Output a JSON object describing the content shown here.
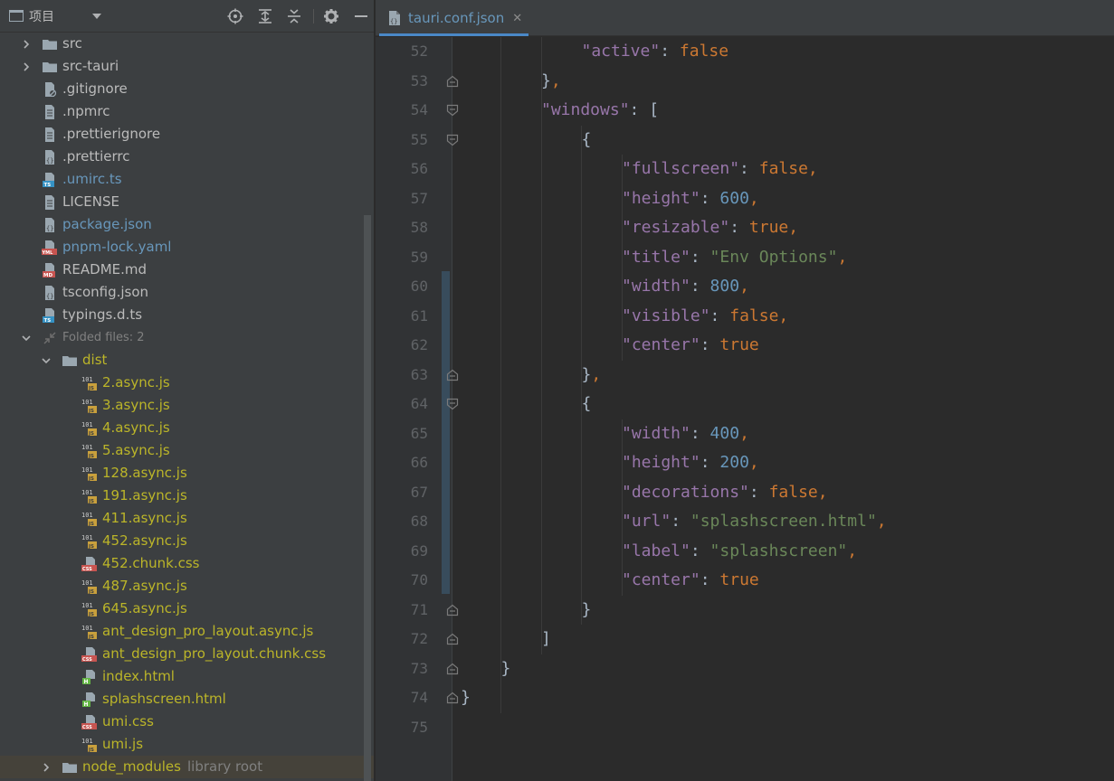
{
  "project_panel": {
    "title": "项目",
    "tree": [
      {
        "label": "src",
        "type": "folder",
        "depth": 0,
        "arrow": "right",
        "color": "default"
      },
      {
        "label": "src-tauri",
        "type": "folder",
        "depth": 0,
        "arrow": "right",
        "color": "default"
      },
      {
        "label": ".gitignore",
        "type": "ignore-file",
        "depth": 0,
        "color": "default"
      },
      {
        "label": ".npmrc",
        "type": "text-file",
        "depth": 0,
        "color": "default"
      },
      {
        "label": ".prettierignore",
        "type": "text-file",
        "depth": 0,
        "color": "default"
      },
      {
        "label": ".prettierrc",
        "type": "json-file",
        "depth": 0,
        "color": "default"
      },
      {
        "label": ".umirc.ts",
        "type": "ts-file",
        "depth": 0,
        "color": "modified"
      },
      {
        "label": "LICENSE",
        "type": "text-file",
        "depth": 0,
        "color": "default"
      },
      {
        "label": "package.json",
        "type": "json-file",
        "depth": 0,
        "color": "modified"
      },
      {
        "label": "pnpm-lock.yaml",
        "type": "yaml-file",
        "depth": 0,
        "color": "modified"
      },
      {
        "label": "README.md",
        "type": "md-file",
        "depth": 0,
        "color": "default"
      },
      {
        "label": "tsconfig.json",
        "type": "json-file",
        "depth": 0,
        "color": "default"
      },
      {
        "label": "typings.d.ts",
        "type": "ts-file",
        "depth": 0,
        "color": "default"
      },
      {
        "label": "Folded files: 2",
        "type": "folded",
        "depth": 0,
        "arrow": "down",
        "color": "dim"
      },
      {
        "label": "dist",
        "type": "folder",
        "depth": 1,
        "arrow": "down",
        "color": "ignored"
      },
      {
        "label": "2.async.js",
        "type": "js-file",
        "depth": 2,
        "color": "ignored"
      },
      {
        "label": "3.async.js",
        "type": "js-file",
        "depth": 2,
        "color": "ignored"
      },
      {
        "label": "4.async.js",
        "type": "js-file",
        "depth": 2,
        "color": "ignored"
      },
      {
        "label": "5.async.js",
        "type": "js-file",
        "depth": 2,
        "color": "ignored"
      },
      {
        "label": "128.async.js",
        "type": "js-file",
        "depth": 2,
        "color": "ignored"
      },
      {
        "label": "191.async.js",
        "type": "js-file",
        "depth": 2,
        "color": "ignored"
      },
      {
        "label": "411.async.js",
        "type": "js-file",
        "depth": 2,
        "color": "ignored"
      },
      {
        "label": "452.async.js",
        "type": "js-file",
        "depth": 2,
        "color": "ignored"
      },
      {
        "label": "452.chunk.css",
        "type": "css-file",
        "depth": 2,
        "color": "ignored"
      },
      {
        "label": "487.async.js",
        "type": "js-file",
        "depth": 2,
        "color": "ignored"
      },
      {
        "label": "645.async.js",
        "type": "js-file",
        "depth": 2,
        "color": "ignored"
      },
      {
        "label": "ant_design_pro_layout.async.js",
        "type": "js-file",
        "depth": 2,
        "color": "ignored"
      },
      {
        "label": "ant_design_pro_layout.chunk.css",
        "type": "css-file",
        "depth": 2,
        "color": "ignored"
      },
      {
        "label": "index.html",
        "type": "html-file",
        "depth": 2,
        "color": "ignored"
      },
      {
        "label": "splashscreen.html",
        "type": "html-file",
        "depth": 2,
        "color": "ignored"
      },
      {
        "label": "umi.css",
        "type": "css-file",
        "depth": 2,
        "color": "ignored"
      },
      {
        "label": "umi.js",
        "type": "js-file",
        "depth": 2,
        "color": "ignored"
      },
      {
        "label": "node_modules",
        "extra": "library root",
        "type": "folder",
        "depth": 1,
        "arrow": "right",
        "color": "ignored",
        "highlight": true
      }
    ]
  },
  "editor": {
    "tab_label": "tauri.conf.json",
    "tab_close": "✕",
    "lines": [
      {
        "num": "52",
        "indent": 5,
        "fold": "",
        "tokens": [
          {
            "t": "\"active\"",
            "c": "k"
          },
          {
            "t": ": ",
            "c": "p"
          },
          {
            "t": "false",
            "c": "b"
          }
        ]
      },
      {
        "num": "53",
        "indent": 4,
        "fold": "end",
        "tokens": [
          {
            "t": "}",
            "c": "p"
          },
          {
            "t": ",",
            "c": "c"
          }
        ]
      },
      {
        "num": "54",
        "indent": 4,
        "fold": "start",
        "tokens": [
          {
            "t": "\"windows\"",
            "c": "k"
          },
          {
            "t": ": [",
            "c": "p"
          }
        ]
      },
      {
        "num": "55",
        "indent": 5,
        "fold": "start",
        "tokens": [
          {
            "t": "{",
            "c": "p"
          }
        ]
      },
      {
        "num": "56",
        "indent": 6,
        "fold": "",
        "tokens": [
          {
            "t": "\"fullscreen\"",
            "c": "k"
          },
          {
            "t": ": ",
            "c": "p"
          },
          {
            "t": "false",
            "c": "b"
          },
          {
            "t": ",",
            "c": "c"
          }
        ]
      },
      {
        "num": "57",
        "indent": 6,
        "fold": "",
        "tokens": [
          {
            "t": "\"height\"",
            "c": "k"
          },
          {
            "t": ": ",
            "c": "p"
          },
          {
            "t": "600",
            "c": "n"
          },
          {
            "t": ",",
            "c": "c"
          }
        ]
      },
      {
        "num": "58",
        "indent": 6,
        "fold": "",
        "tokens": [
          {
            "t": "\"resizable\"",
            "c": "k"
          },
          {
            "t": ": ",
            "c": "p"
          },
          {
            "t": "true",
            "c": "b"
          },
          {
            "t": ",",
            "c": "c"
          }
        ]
      },
      {
        "num": "59",
        "indent": 6,
        "fold": "",
        "tokens": [
          {
            "t": "\"title\"",
            "c": "k"
          },
          {
            "t": ": ",
            "c": "p"
          },
          {
            "t": "\"Env Options\"",
            "c": "s"
          },
          {
            "t": ",",
            "c": "c"
          }
        ]
      },
      {
        "num": "60",
        "indent": 6,
        "fold": "",
        "tokens": [
          {
            "t": "\"width\"",
            "c": "k"
          },
          {
            "t": ": ",
            "c": "p"
          },
          {
            "t": "800",
            "c": "n"
          },
          {
            "t": ",",
            "c": "c"
          }
        ]
      },
      {
        "num": "61",
        "indent": 6,
        "fold": "",
        "tokens": [
          {
            "t": "\"visible\"",
            "c": "k"
          },
          {
            "t": ": ",
            "c": "p"
          },
          {
            "t": "false",
            "c": "b"
          },
          {
            "t": ",",
            "c": "c"
          }
        ]
      },
      {
        "num": "62",
        "indent": 6,
        "fold": "",
        "tokens": [
          {
            "t": "\"center\"",
            "c": "k"
          },
          {
            "t": ": ",
            "c": "p"
          },
          {
            "t": "true",
            "c": "b"
          }
        ]
      },
      {
        "num": "63",
        "indent": 5,
        "fold": "end",
        "tokens": [
          {
            "t": "}",
            "c": "p"
          },
          {
            "t": ",",
            "c": "c"
          }
        ]
      },
      {
        "num": "64",
        "indent": 5,
        "fold": "start",
        "tokens": [
          {
            "t": "{",
            "c": "p"
          }
        ]
      },
      {
        "num": "65",
        "indent": 6,
        "fold": "",
        "tokens": [
          {
            "t": "\"width\"",
            "c": "k"
          },
          {
            "t": ": ",
            "c": "p"
          },
          {
            "t": "400",
            "c": "n"
          },
          {
            "t": ",",
            "c": "c"
          }
        ]
      },
      {
        "num": "66",
        "indent": 6,
        "fold": "",
        "tokens": [
          {
            "t": "\"height\"",
            "c": "k"
          },
          {
            "t": ": ",
            "c": "p"
          },
          {
            "t": "200",
            "c": "n"
          },
          {
            "t": ",",
            "c": "c"
          }
        ]
      },
      {
        "num": "67",
        "indent": 6,
        "fold": "",
        "tokens": [
          {
            "t": "\"decorations\"",
            "c": "k"
          },
          {
            "t": ": ",
            "c": "p"
          },
          {
            "t": "false",
            "c": "b"
          },
          {
            "t": ",",
            "c": "c"
          }
        ]
      },
      {
        "num": "68",
        "indent": 6,
        "fold": "",
        "tokens": [
          {
            "t": "\"url\"",
            "c": "k"
          },
          {
            "t": ": ",
            "c": "p"
          },
          {
            "t": "\"splashscreen.html\"",
            "c": "s"
          },
          {
            "t": ",",
            "c": "c"
          }
        ]
      },
      {
        "num": "69",
        "indent": 6,
        "fold": "",
        "tokens": [
          {
            "t": "\"label\"",
            "c": "k"
          },
          {
            "t": ": ",
            "c": "p"
          },
          {
            "t": "\"splashscreen\"",
            "c": "s"
          },
          {
            "t": ",",
            "c": "c"
          }
        ]
      },
      {
        "num": "70",
        "indent": 6,
        "fold": "",
        "tokens": [
          {
            "t": "\"center\"",
            "c": "k"
          },
          {
            "t": ": ",
            "c": "p"
          },
          {
            "t": "true",
            "c": "b"
          }
        ]
      },
      {
        "num": "71",
        "indent": 5,
        "fold": "end",
        "tokens": [
          {
            "t": "}",
            "c": "p"
          }
        ]
      },
      {
        "num": "72",
        "indent": 4,
        "fold": "end",
        "tokens": [
          {
            "t": "]",
            "c": "p"
          }
        ]
      },
      {
        "num": "73",
        "indent": 3,
        "fold": "end",
        "tokens": [
          {
            "t": "}",
            "c": "p"
          }
        ]
      },
      {
        "num": "74",
        "indent": 2,
        "fold": "end",
        "tokens": [
          {
            "t": "}",
            "c": "p"
          }
        ]
      },
      {
        "num": "75",
        "indent": 0,
        "fold": "",
        "tokens": []
      }
    ]
  },
  "colors": {
    "panel_bg": "#3c3f41",
    "editor_bg": "#2b2b2b",
    "modified": "#6897bb",
    "ignored": "#bbb529",
    "json_key": "#9876aa",
    "json_string": "#6a8759",
    "json_number": "#6897bb",
    "json_keyword": "#cc7832"
  }
}
